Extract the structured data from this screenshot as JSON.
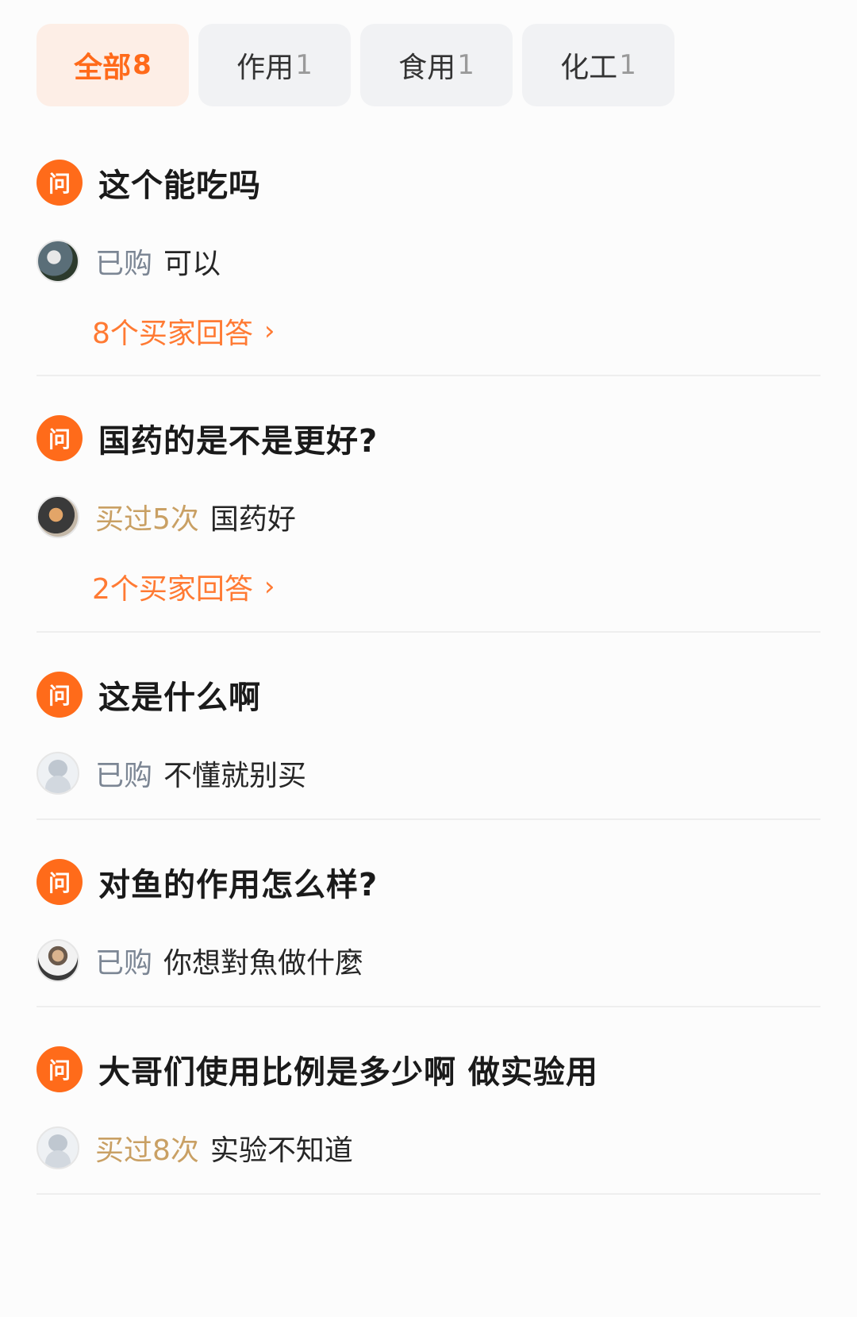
{
  "tabs": [
    {
      "label": "全部",
      "count": "8"
    },
    {
      "label": "作用",
      "count": "1"
    },
    {
      "label": "食用",
      "count": "1"
    },
    {
      "label": "化工",
      "count": "1"
    }
  ],
  "badge_text": "问",
  "qa": [
    {
      "question": "这个能吃吗",
      "tag": "已购",
      "answer": "可以",
      "more": "8个买家回答"
    },
    {
      "question": "国药的是不是更好?",
      "tag": "买过5次",
      "answer": "国药好",
      "more": "2个买家回答"
    },
    {
      "question": "这是什么啊",
      "tag": "已购",
      "answer": "不懂就别买"
    },
    {
      "question": "对鱼的作用怎么样?",
      "tag": "已购",
      "answer": "你想對魚做什麼"
    },
    {
      "question": "大哥们使用比例是多少啊 做实验用",
      "tag": "买过8次",
      "answer": "实验不知道"
    }
  ],
  "colors": {
    "accent": "#ff6b1a",
    "tag_gray": "#7c8694",
    "tag_gold": "#c9a064"
  }
}
